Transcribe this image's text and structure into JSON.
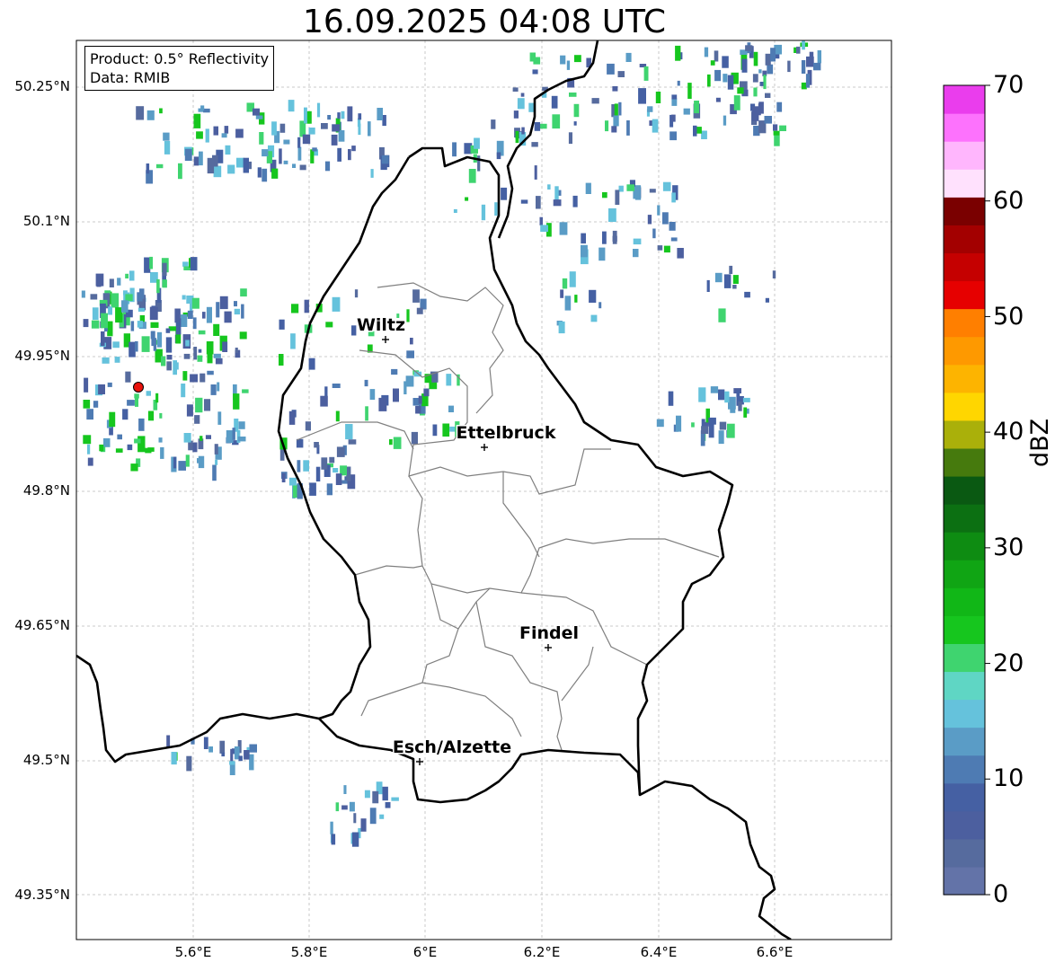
{
  "title": "16.09.2025 04:08 UTC",
  "info": {
    "product": "Product: 0.5° Reflectivity",
    "source": "Data: RMIB"
  },
  "lat_ticks": [
    "50.25°N",
    "50.1°N",
    "49.95°N",
    "49.8°N",
    "49.65°N",
    "49.5°N",
    "49.35°N"
  ],
  "lon_ticks": [
    "5.6°E",
    "5.8°E",
    "6°E",
    "6.2°E",
    "6.4°E",
    "6.6°E"
  ],
  "colorbar": {
    "label": "dBZ",
    "ticks": [
      "0",
      "10",
      "20",
      "30",
      "40",
      "50",
      "60",
      "70"
    ],
    "colors": [
      "#6373a8",
      "#566b9e",
      "#4c5f9f",
      "#4560a3",
      "#4e7bb3",
      "#5a9cc6",
      "#65c2dc",
      "#5fd6c4",
      "#3fd46f",
      "#16c61e",
      "#11b717",
      "#10a514",
      "#0e8c12",
      "#0c7012",
      "#0a5912",
      "#467a0d",
      "#aab00a",
      "#ffd600",
      "#fdb400",
      "#fe9900",
      "#ff7f00",
      "#e60000",
      "#c50000",
      "#a30000",
      "#7a0000",
      "#ffe1fd",
      "#ffb6fd",
      "#fd72fd",
      "#ea3ded"
    ]
  },
  "cities": [
    {
      "name": "Wiltz"
    },
    {
      "name": "Ettelbruck"
    },
    {
      "name": "Findel"
    },
    {
      "name": "Esch/Alzette"
    }
  ],
  "radar_site": {
    "color": "#e8120c"
  },
  "colors": {
    "border": "#000000",
    "cantons": "#7f7f7f",
    "grid": "#bbbbbb"
  }
}
